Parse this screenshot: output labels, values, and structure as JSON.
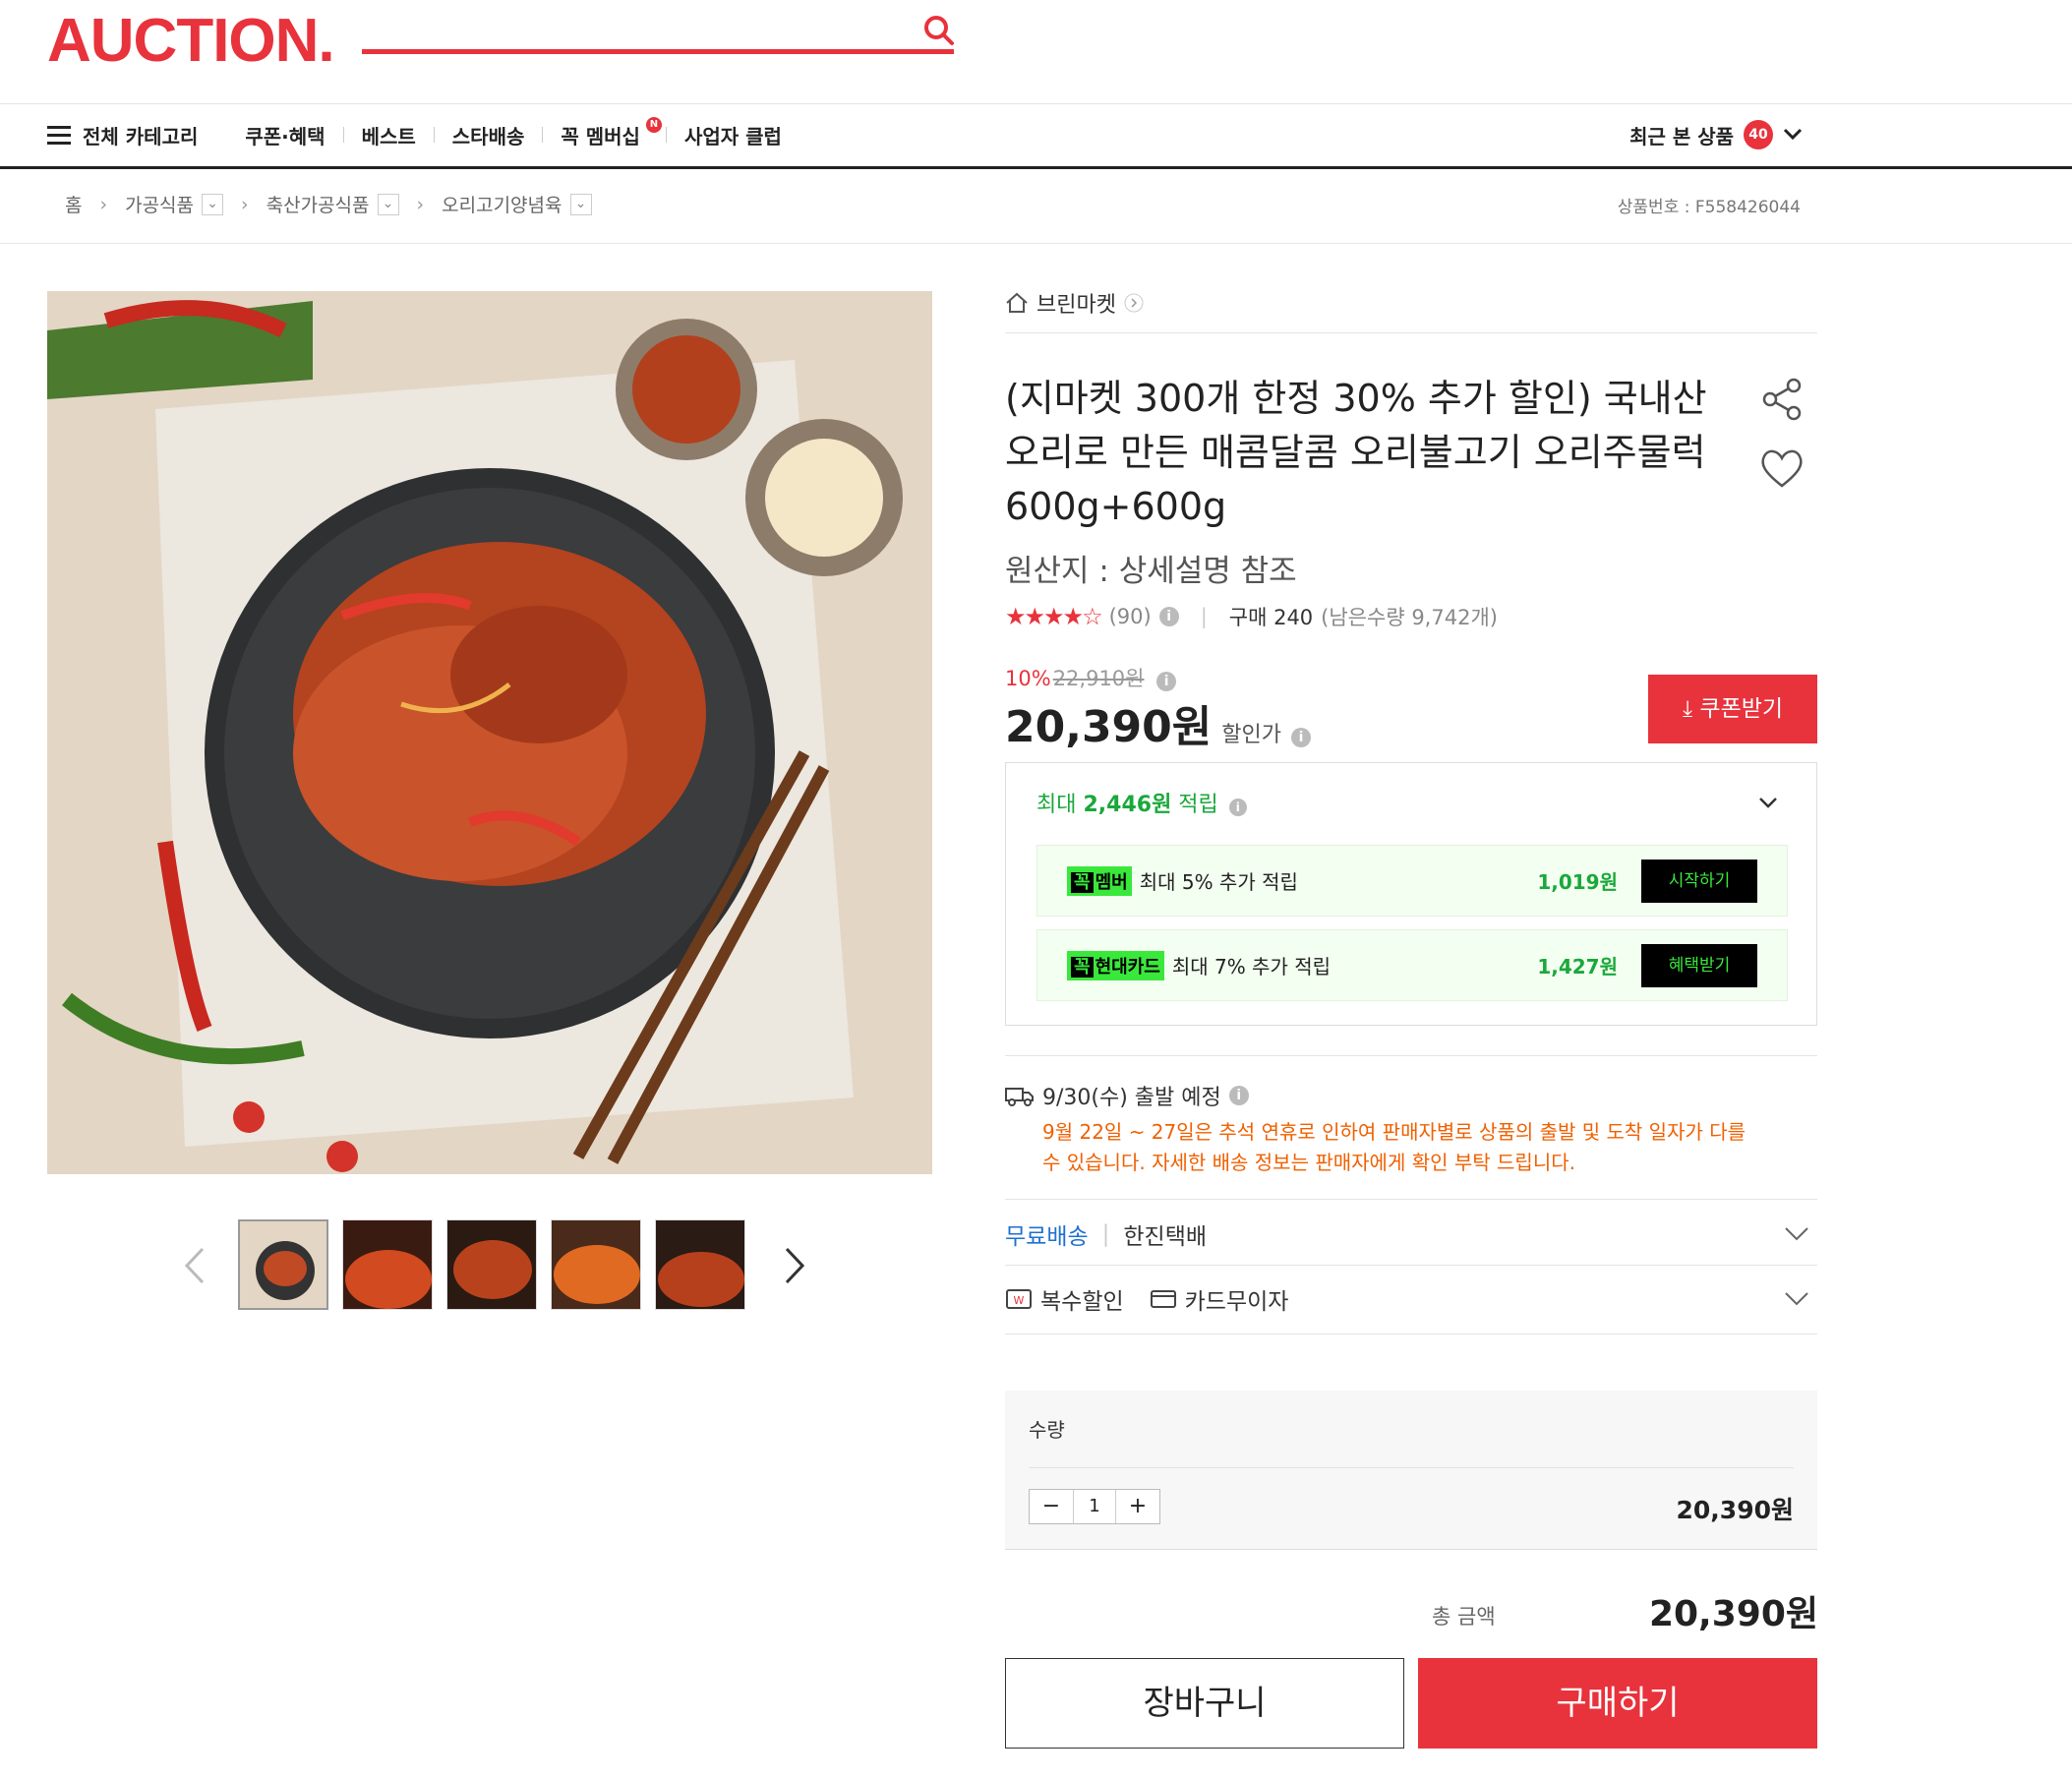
{
  "header": {
    "logo": "AUCTION."
  },
  "nav": {
    "all_categories": "전체 카테고리",
    "items": [
      "쿠폰·혜택",
      "베스트",
      "스타배송",
      "꼭 멤버십",
      "사업자 클럽"
    ],
    "new_badge": "N",
    "recent_label": "최근 본 상품",
    "recent_count": "40"
  },
  "breadcrumb": {
    "home": "홈",
    "items": [
      "가공식품",
      "축산가공식품",
      "오리고기양념육"
    ],
    "product_no": "상품번호 : F558426044"
  },
  "product": {
    "seller": "브린마켓",
    "title": "(지마켓 300개 한정 30% 추가 할인) 국내산 오리로 만든 매콤달콤 오리불고기 오리주물럭 600g+600g",
    "origin": "원산지 : 상세설명 참조",
    "stars": "★★★★☆",
    "rating_count": "(90)",
    "purchase": "구매 240",
    "stock": "(남은수량 9,742개)",
    "discount_rate": "10%",
    "original_price": "22,910원",
    "price": "20,390원",
    "price_label": "할인가",
    "coupon_button": "쿠폰받기"
  },
  "reward": {
    "title_prefix": "최대 ",
    "title_amount": "2,446원",
    "title_suffix": " 적립",
    "rows": [
      {
        "tag_a": "꼭",
        "tag_b": "멤버",
        "text": "최대 5% 추가 적립",
        "amount": "1,019원",
        "button": "시작하기"
      },
      {
        "tag_a": "꼭",
        "tag_b": "현대카드",
        "text": "최대 7% 추가 적립",
        "amount": "1,427원",
        "button": "혜택받기"
      }
    ]
  },
  "shipping": {
    "date": "9/30(수) 출발 예정",
    "note": "9월 22일 ~ 27일은 추석 연휴로 인하여 판매자별로 상품의 출발 및 도착 일자가 다를 수 있습니다. 자세한 배송 정보는 판매자에게 확인 부탁 드립니다.",
    "free": "무료배송",
    "courier": "한진택배",
    "multi_discount": "복수할인",
    "card_installment": "카드무이자"
  },
  "order": {
    "qty_label": "수량",
    "qty": "1",
    "line_total": "20,390원",
    "total_label": "총 금액",
    "total": "20,390원",
    "cart_button": "장바구니",
    "buy_button": "구매하기"
  },
  "colors": {
    "brand": "#e8323c",
    "reward_green": "#1aa83b",
    "notice_orange": "#f06000"
  }
}
